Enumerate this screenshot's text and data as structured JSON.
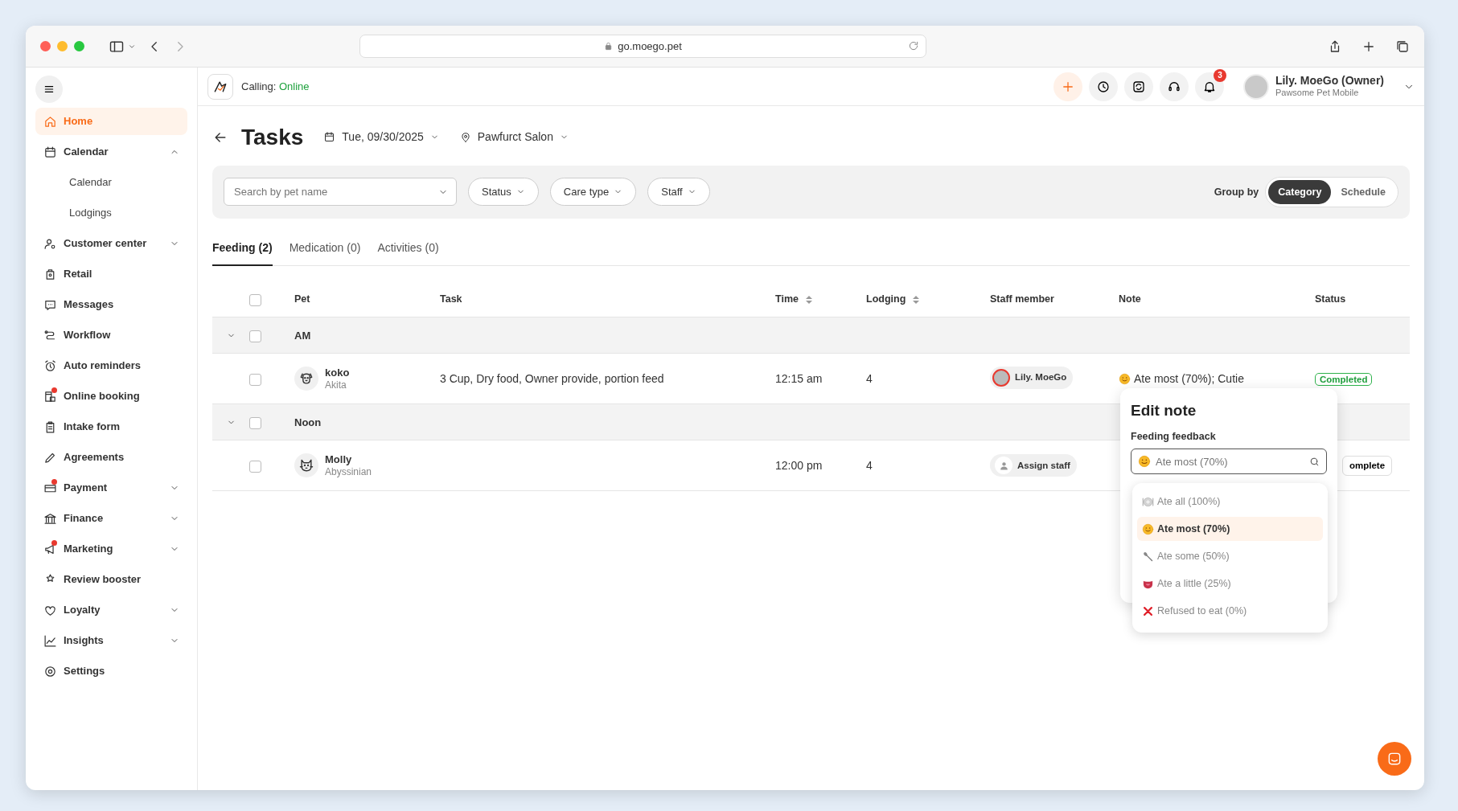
{
  "browser": {
    "url": "go.moego.pet"
  },
  "sidebar": {
    "items": [
      {
        "label": "Home",
        "kind": "link",
        "selected": true,
        "alert": false
      },
      {
        "label": "Calendar",
        "kind": "group",
        "selected": false,
        "alert": false,
        "expanded": true,
        "children": [
          {
            "label": "Calendar",
            "selected": false
          },
          {
            "label": "Lodgings",
            "selected": false
          }
        ]
      },
      {
        "label": "Customer center",
        "kind": "group",
        "selected": false,
        "alert": false,
        "expanded": false
      },
      {
        "label": "Retail",
        "kind": "link",
        "selected": false,
        "alert": false
      },
      {
        "label": "Messages",
        "kind": "link",
        "selected": false,
        "alert": false
      },
      {
        "label": "Workflow",
        "kind": "link",
        "selected": false,
        "alert": false
      },
      {
        "label": "Auto reminders",
        "kind": "link",
        "selected": false,
        "alert": false
      },
      {
        "label": "Online booking",
        "kind": "link",
        "selected": false,
        "alert": true
      },
      {
        "label": "Intake form",
        "kind": "link",
        "selected": false,
        "alert": false
      },
      {
        "label": "Agreements",
        "kind": "link",
        "selected": false,
        "alert": false
      },
      {
        "label": "Payment",
        "kind": "group",
        "selected": false,
        "alert": true,
        "expanded": false
      },
      {
        "label": "Finance",
        "kind": "group",
        "selected": false,
        "alert": false,
        "expanded": false
      },
      {
        "label": "Marketing",
        "kind": "group",
        "selected": false,
        "alert": true,
        "expanded": false
      },
      {
        "label": "Review booster",
        "kind": "link",
        "selected": false,
        "alert": false
      },
      {
        "label": "Loyalty",
        "kind": "group",
        "selected": false,
        "alert": false,
        "expanded": false
      },
      {
        "label": "Insights",
        "kind": "group",
        "selected": false,
        "alert": false,
        "expanded": false
      },
      {
        "label": "Settings",
        "kind": "link",
        "selected": false,
        "alert": false
      }
    ]
  },
  "header": {
    "calling_label": "Calling:",
    "calling_status": "Online",
    "notifications": "3",
    "user": {
      "name": "Lily. MoeGo (Owner)",
      "business": "Pawsome Pet Mobile"
    }
  },
  "page": {
    "title": "Tasks",
    "date": "Tue, 09/30/2025",
    "location": "Pawfurct Salon"
  },
  "filters": {
    "search": {
      "placeholder": "Search by pet name"
    },
    "dropdowns": [
      "Status",
      "Care type",
      "Staff"
    ],
    "group_by": {
      "label": "Group by",
      "options": [
        {
          "label": "Category",
          "selected": true
        },
        {
          "label": "Schedule",
          "selected": false
        }
      ]
    }
  },
  "tabs": [
    {
      "label": "Feeding (2)",
      "selected": true
    },
    {
      "label": "Medication (0)",
      "selected": false
    },
    {
      "label": "Activities (0)",
      "selected": false
    }
  ],
  "table": {
    "header_checked": false,
    "columns": [
      {
        "label": "Pet",
        "sortable": false
      },
      {
        "label": "Task",
        "sortable": false
      },
      {
        "label": "Time",
        "sortable": true
      },
      {
        "label": "Lodging",
        "sortable": true
      },
      {
        "label": "Staff member",
        "sortable": false
      },
      {
        "label": "Note",
        "sortable": false
      },
      {
        "label": "Status",
        "sortable": false
      }
    ],
    "groups": [
      {
        "label": "AM",
        "expanded": true,
        "checked": false,
        "rows": [
          {
            "checked": false,
            "pet": "koko",
            "breed": "Akita",
            "task": "3 Cup, Dry food, Owner provide, portion feed",
            "time": "12:15 am",
            "lodging": "4",
            "staff": {
              "kind": "assigned",
              "label": "Lily. MoeGo"
            },
            "note": "Ate most (70%); Cutie",
            "status": {
              "kind": "completed",
              "label": "Completed"
            }
          }
        ]
      },
      {
        "label": "Noon",
        "expanded": true,
        "checked": false,
        "rows": [
          {
            "checked": false,
            "pet": "Molly",
            "breed": "Abyssinian",
            "time": "12:00 pm",
            "lodging": "4",
            "staff": {
              "kind": "unassigned",
              "label": "Assign staff"
            },
            "status": {
              "kind": "action",
              "label": "omplete"
            }
          }
        ]
      }
    ]
  },
  "edit_note": {
    "title": "Edit note",
    "label": "Feeding feedback",
    "input": {
      "placeholder": "Ate most (70%)"
    },
    "options": [
      {
        "label": "Ate all (100%)",
        "selected": false
      },
      {
        "label": "Ate most (70%)",
        "selected": true
      },
      {
        "label": "Ate some (50%)",
        "selected": false
      },
      {
        "label": "Ate a little (25%)",
        "selected": false
      },
      {
        "label": "Refused to eat (0%)",
        "selected": false
      }
    ]
  }
}
